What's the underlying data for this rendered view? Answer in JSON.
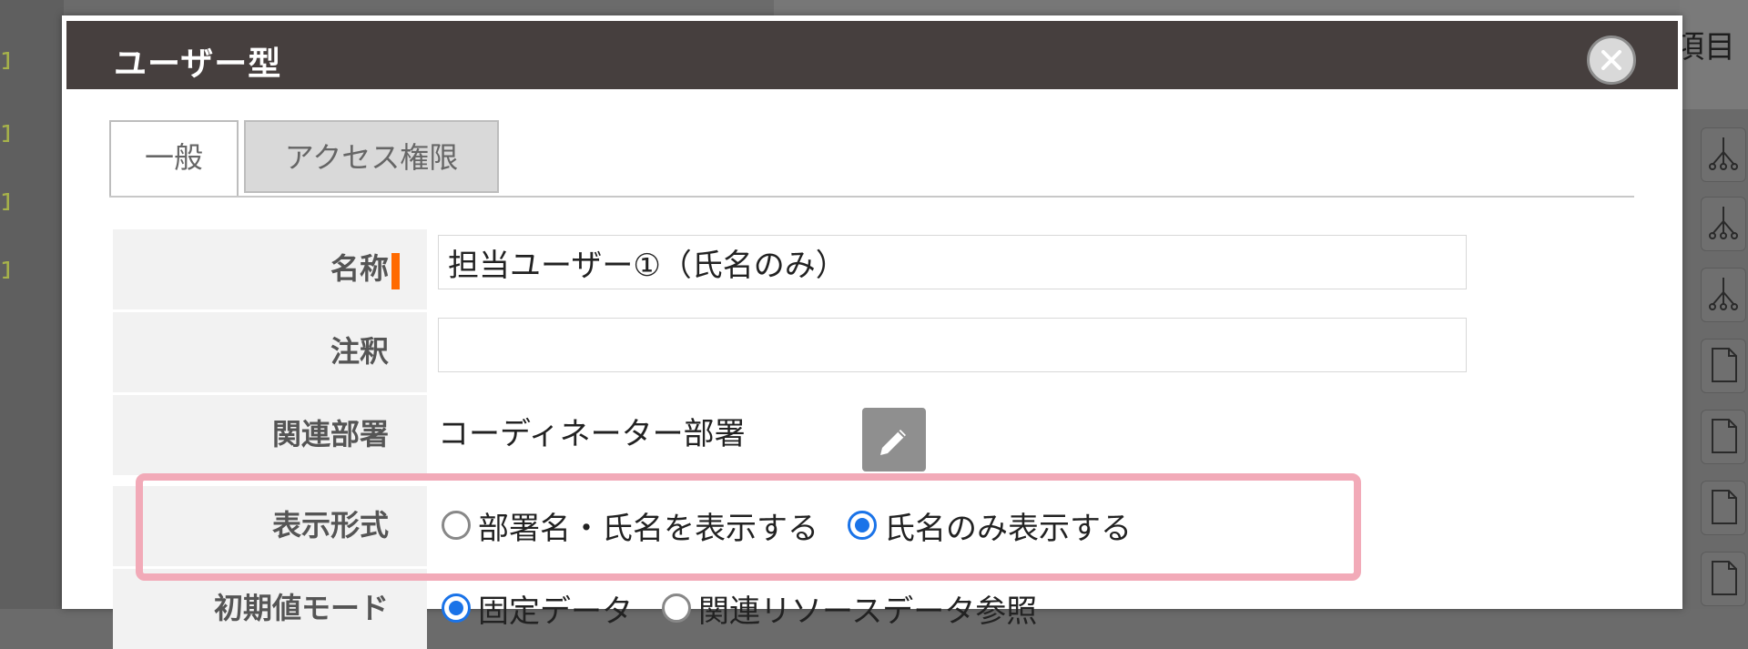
{
  "dialog": {
    "title": "ユーザー型",
    "tabs": [
      {
        "label": "一般",
        "active": true
      },
      {
        "label": "アクセス権限",
        "active": false
      }
    ]
  },
  "form": {
    "name": {
      "label": "名称",
      "value": "担当ユーザー①（氏名のみ）",
      "required": true
    },
    "note": {
      "label": "注釈",
      "value": ""
    },
    "department": {
      "label": "関連部署",
      "value": "コーディネーター部署"
    },
    "display_format": {
      "label": "表示形式",
      "options": [
        {
          "label": "部署名・氏名を表示する",
          "checked": false
        },
        {
          "label": "氏名のみ表示する",
          "checked": true
        }
      ]
    },
    "initial_mode": {
      "label": "初期値モード",
      "options": [
        {
          "label": "固定データ",
          "checked": true
        },
        {
          "label": "関連リソースデータ参照",
          "checked": false
        }
      ]
    }
  },
  "background": {
    "right_title": "項目"
  },
  "colors": {
    "titlebar": "#463f3e",
    "required_marker": "#ff6a00",
    "radio_selected": "#1a73e8",
    "highlight": "#f2aab8"
  },
  "icons": {
    "close": "close-icon",
    "edit": "pencil-icon"
  }
}
